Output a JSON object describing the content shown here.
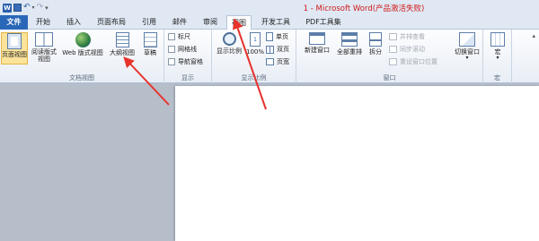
{
  "window": {
    "title": "1 - Microsoft Word(产品激活失败)"
  },
  "tabs": [
    {
      "label": "文件"
    },
    {
      "label": "开始"
    },
    {
      "label": "插入"
    },
    {
      "label": "页面布局"
    },
    {
      "label": "引用"
    },
    {
      "label": "邮件"
    },
    {
      "label": "审阅"
    },
    {
      "label": "视图"
    },
    {
      "label": "开发工具"
    },
    {
      "label": "PDF工具集"
    }
  ],
  "groups": {
    "views": {
      "label": "文档视图",
      "print_layout": "页面视图",
      "reading_layout": "阅读版式视图",
      "web_layout": "Web 版式视图",
      "outline": "大纲视图",
      "draft": "草稿"
    },
    "show": {
      "label": "显示",
      "ruler": "标尺",
      "gridlines": "网格线",
      "nav_pane": "导航窗格"
    },
    "zoom": {
      "label": "显示比例",
      "zoom": "显示比例",
      "percent": "100%",
      "one_page": "单页",
      "two_pages": "双页",
      "page_width": "页宽"
    },
    "window": {
      "label": "窗口",
      "new_window": "新建窗口",
      "arrange_all": "全部重排",
      "split": "拆分",
      "side_by_side": "并排查看",
      "sync_scroll": "同步滚动",
      "reset_position": "重设窗口位置",
      "switch_windows": "切换窗口"
    },
    "macros": {
      "label": "宏",
      "macros": "宏"
    }
  },
  "colors": {
    "accent": "#2a67b8",
    "arrow": "#e8322c",
    "selected": "#fbe39a"
  }
}
